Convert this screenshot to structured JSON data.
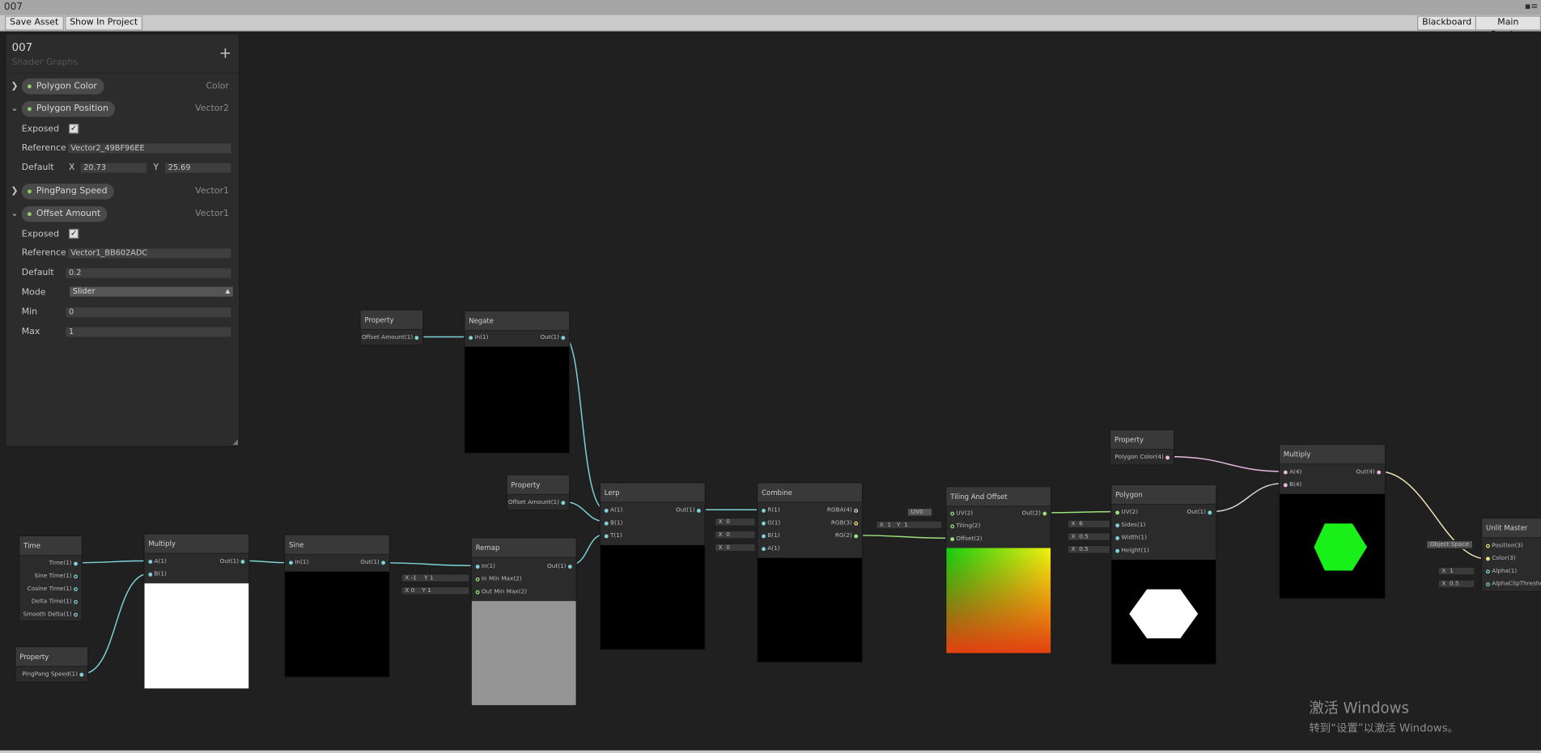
{
  "window": {
    "title": "007"
  },
  "toolbar": {
    "save_asset": "Save Asset",
    "show_in_project": "Show In Project",
    "blackboard": "Blackboard",
    "main_preview": "Main Preview"
  },
  "blackboard": {
    "title": "007",
    "subtitle": "Shader Graphs",
    "add": "+",
    "properties": [
      {
        "name": "Polygon Color",
        "type": "Color",
        "expanded": false
      },
      {
        "name": "Polygon Position",
        "type": "Vector2",
        "expanded": true,
        "exposed_label": "Exposed",
        "reference_label": "Reference",
        "reference": "Vector2_49BF96EE",
        "default_label": "Default",
        "x_label": "X",
        "x": "20.73",
        "y_label": "Y",
        "y": "25.69"
      },
      {
        "name": "PingPang Speed",
        "type": "Vector1",
        "expanded": false
      },
      {
        "name": "Offset Amount",
        "type": "Vector1",
        "expanded": true,
        "exposed_label": "Exposed",
        "reference_label": "Reference",
        "reference": "Vector1_BB602ADC",
        "default_label": "Default",
        "default": "0.2",
        "mode_label": "Mode",
        "mode": "Slider",
        "min_label": "Min",
        "min": "0",
        "max_label": "Max",
        "max": "1"
      }
    ]
  },
  "nodes": {
    "prop_offset1": {
      "title": "Property",
      "port": "Offset Amount(1)"
    },
    "negate": {
      "title": "Negate",
      "in": "In(1)",
      "out": "Out(1)"
    },
    "prop_offset2": {
      "title": "Property",
      "port": "Offset Amount(1)"
    },
    "time": {
      "title": "Time",
      "ports": [
        "Time(1)",
        "Sine Time(1)",
        "Cosine Time(1)",
        "Delta Time(1)",
        "Smooth Delta(1)"
      ]
    },
    "prop_pingpang": {
      "title": "Property",
      "port": "PingPang Speed(1)"
    },
    "multiply1": {
      "title": "Multiply",
      "a": "A(1)",
      "b": "B(1)",
      "out": "Out(1)"
    },
    "sine": {
      "title": "Sine",
      "in": "In(1)",
      "out": "Out(1)"
    },
    "remap": {
      "title": "Remap",
      "in": "In(1)",
      "in_min_max": "In Min Max(2)",
      "out_min_max": "Out Min Max(2)",
      "out": "Out(1)",
      "in_x": "-1",
      "in_y": "1",
      "out_x": "0",
      "out_y": "1"
    },
    "lerp": {
      "title": "Lerp",
      "a": "A(1)",
      "b": "B(1)",
      "t": "T(1)",
      "out": "Out(1)"
    },
    "combine": {
      "title": "Combine",
      "r": "R(1)",
      "g": "G(1)",
      "b": "B(1)",
      "a": "A(1)",
      "rgba": "RGBA(4)",
      "rgb": "RGB(3)",
      "rg": "RG(2)",
      "g_val": "0",
      "b_val": "0",
      "a_val": "0"
    },
    "tiling": {
      "title": "Tiling And Offset",
      "uv": "UV(2)",
      "tiling": "Tiling(2)",
      "offset": "Offset(2)",
      "out": "Out(2)",
      "uv_val": "UV0",
      "tx": "1",
      "ty": "1"
    },
    "polygon": {
      "title": "Polygon",
      "uv": "UV(2)",
      "sides": "Sides(1)",
      "width": "Width(1)",
      "height": "Height(1)",
      "out": "Out(1)",
      "sides_val": "6",
      "width_val": "0.5",
      "height_val": "0.5"
    },
    "prop_color": {
      "title": "Property",
      "port": "Polygon Color(4)"
    },
    "multiply2": {
      "title": "Multiply",
      "a": "A(4)",
      "b": "B(4)",
      "out": "Out(4)"
    },
    "master": {
      "title": "Unlit Master",
      "position": "Position(3)",
      "color": "Color(3)",
      "alpha": "Alpha(1)",
      "clip": "AlphaClipThreshold",
      "space": "Object Space",
      "alpha_val": "1",
      "clip_val": "0.5"
    }
  },
  "watermark": {
    "line1": "激活 Windows",
    "line2": "转到“设置”以激活 Windows。"
  },
  "colors": {
    "float_wire": "#7dd3d8",
    "vec_wire": "#9be27a",
    "color_wire": "#e9b8e0"
  }
}
